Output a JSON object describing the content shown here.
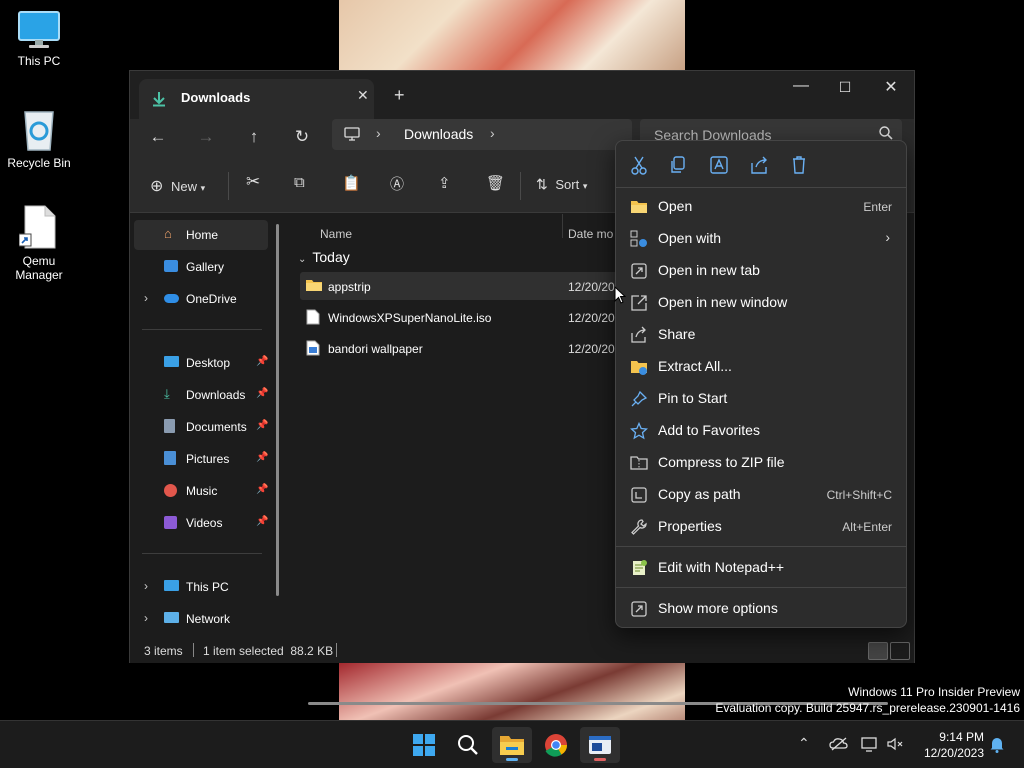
{
  "desktop": {
    "icons": [
      {
        "label": "This PC",
        "icon": "monitor-icon"
      },
      {
        "label": "Recycle Bin",
        "icon": "recycle-bin-icon"
      },
      {
        "label": "Qemu Manager",
        "icon": "shortcut-file-icon"
      }
    ]
  },
  "window": {
    "tab_title": "Downloads",
    "breadcrumb": "Downloads",
    "search_placeholder": "Search Downloads",
    "commands": {
      "new": "New",
      "sort": "Sort"
    }
  },
  "sidebar": {
    "items": [
      {
        "label": "Home",
        "icon": "home-icon"
      },
      {
        "label": "Gallery",
        "icon": "gallery-icon"
      },
      {
        "label": "OneDrive",
        "icon": "onedrive-icon"
      },
      {
        "label": "Desktop",
        "icon": "desktop-folder-icon"
      },
      {
        "label": "Downloads",
        "icon": "downloads-folder-icon"
      },
      {
        "label": "Documents",
        "icon": "documents-folder-icon"
      },
      {
        "label": "Pictures",
        "icon": "pictures-folder-icon"
      },
      {
        "label": "Music",
        "icon": "music-folder-icon"
      },
      {
        "label": "Videos",
        "icon": "videos-folder-icon"
      },
      {
        "label": "This PC",
        "icon": "this-pc-icon"
      },
      {
        "label": "Network",
        "icon": "network-icon"
      }
    ]
  },
  "list": {
    "columns": {
      "name": "Name",
      "date": "Date mo"
    },
    "group": "Today",
    "rows": [
      {
        "name": "appstrip",
        "date": "12/20/20",
        "icon": "folder-icon"
      },
      {
        "name": "WindowsXPSuperNanoLite.iso",
        "date": "12/20/20",
        "icon": "file-icon"
      },
      {
        "name": "bandori wallpaper",
        "date": "12/20/20",
        "icon": "image-file-icon"
      }
    ]
  },
  "status": {
    "count": "3 items",
    "selection": "1 item selected  88.2 KB"
  },
  "context_menu": {
    "quick_actions": [
      "cut-icon",
      "copy-icon",
      "rename-icon",
      "share-icon",
      "delete-icon"
    ],
    "items": [
      {
        "label": "Open",
        "shortcut": "Enter",
        "icon": "folder-open-icon"
      },
      {
        "label": "Open with",
        "shortcut": "",
        "icon": "open-with-icon"
      },
      {
        "label": "Open in new tab",
        "shortcut": "",
        "icon": "new-tab-icon"
      },
      {
        "label": "Open in new window",
        "shortcut": "",
        "icon": "new-window-icon"
      },
      {
        "label": "Share",
        "shortcut": "",
        "icon": "share-icon"
      },
      {
        "label": "Extract All...",
        "shortcut": "",
        "icon": "extract-icon"
      },
      {
        "label": "Pin to Start",
        "shortcut": "",
        "icon": "pin-icon"
      },
      {
        "label": "Add to Favorites",
        "shortcut": "",
        "icon": "star-icon"
      },
      {
        "label": "Compress to ZIP file",
        "shortcut": "",
        "icon": "zip-icon"
      },
      {
        "label": "Copy as path",
        "shortcut": "Ctrl+Shift+C",
        "icon": "copy-path-icon"
      },
      {
        "label": "Properties",
        "shortcut": "Alt+Enter",
        "icon": "wrench-icon"
      },
      {
        "label": "Edit with Notepad++",
        "shortcut": "",
        "icon": "notepad-plus-icon"
      },
      {
        "label": "Show more options",
        "shortcut": "",
        "icon": "more-options-icon"
      }
    ]
  },
  "watermark": {
    "line1": "Windows 11 Pro Insider Preview",
    "line2": "Evaluation copy. Build 25947.rs_prerelease.230901-1416"
  },
  "taskbar": {
    "apps": [
      "windows-start-icon",
      "search-icon",
      "file-explorer-icon",
      "chrome-icon",
      "app-icon"
    ],
    "time": "9:14 PM",
    "date": "12/20/2023"
  }
}
